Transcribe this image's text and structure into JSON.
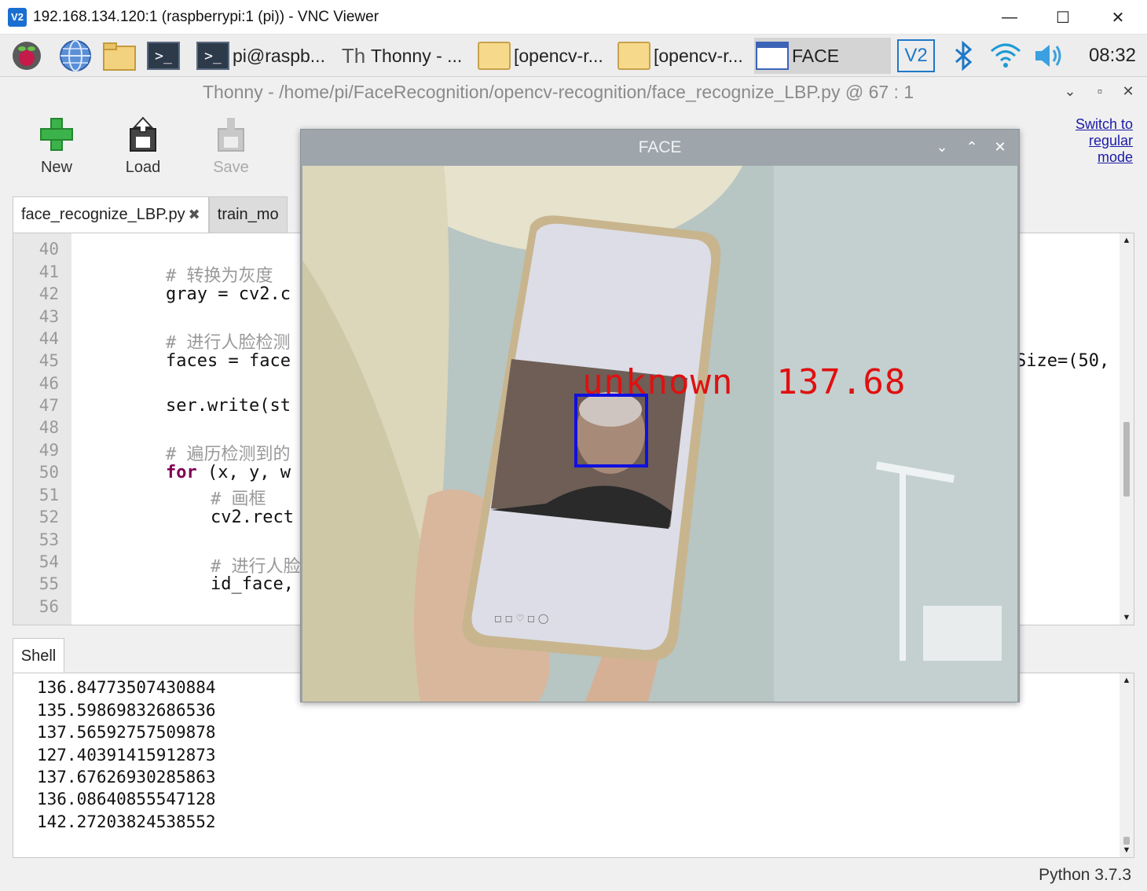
{
  "vnc": {
    "logo": "V2",
    "title": "192.168.134.120:1 (raspberrypi:1 (pi)) - VNC Viewer",
    "minimize": "—",
    "maximize": "☐",
    "close": "✕"
  },
  "taskbar": {
    "launchers": [
      "raspberry-menu-icon",
      "web-browser-icon",
      "file-manager-icon",
      "terminal-icon"
    ],
    "tasks": [
      {
        "label": "pi@raspb...",
        "icon": "terminal-icon"
      },
      {
        "label": "Thonny  -  ...",
        "icon": "thonny-icon"
      },
      {
        "label": "[opencv-r...",
        "icon": "folder-icon"
      },
      {
        "label": "[opencv-r...",
        "icon": "folder-icon"
      },
      {
        "label": "FACE",
        "icon": "window-icon"
      }
    ],
    "clock": "08:32"
  },
  "thonny": {
    "title": "Thonny  -  /home/pi/FaceRecognition/opencv-recognition/face_recognize_LBP.py  @  67 : 1",
    "toolbar": {
      "new": "New",
      "load": "Load",
      "save": "Save"
    },
    "switch_mode": [
      "Switch to",
      "regular",
      "mode"
    ],
    "tabs": [
      {
        "label": "face_recognize_LBP.py",
        "close": "✖"
      },
      {
        "label": "train_mo"
      }
    ],
    "line_numbers": [
      "40",
      "41",
      "42",
      "43",
      "44",
      "45",
      "46",
      "47",
      "48",
      "49",
      "50",
      "51",
      "52",
      "53",
      "54",
      "55",
      "56"
    ],
    "code_visible": {
      "l41": "# 转换为灰度",
      "l42": "gray = cv2.c",
      "l44": "# 进行人脸检测",
      "l45": "faces = face",
      "l45_right": "Size=(50,",
      "l47": "ser.write(st",
      "l49": "# 遍历检测到的",
      "l50_kw": "for",
      "l50": " (x, y, w",
      "l51": "# 画框",
      "l52": "cv2.rect",
      "l54": "# 进行人脸",
      "l55": "id_face,"
    },
    "shell_tab": "Shell",
    "shell_output": [
      "136.84773507430884",
      "135.59869832686536",
      "137.56592757509878",
      "127.40391415912873",
      "137.67626930285863",
      "136.08640855547128",
      "142.27203824538552"
    ],
    "status": "Python 3.7.3"
  },
  "face_window": {
    "title": "FACE",
    "overlay_text": "unknown  137.68",
    "overlay_color": "#e01010",
    "box_color": "#1010e0"
  }
}
